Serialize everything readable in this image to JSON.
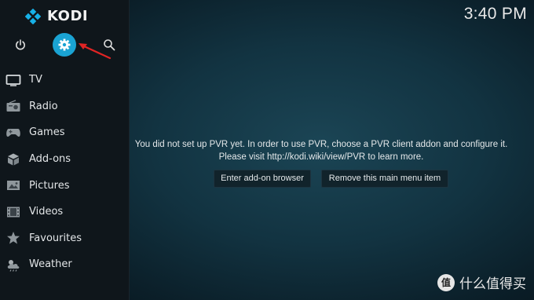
{
  "app": {
    "brand": "KODI",
    "clock": "3:40 PM"
  },
  "top_icons": [
    "power-icon",
    "settings-icon",
    "search-icon"
  ],
  "menu": [
    {
      "label": "TV",
      "icon": "tv-icon"
    },
    {
      "label": "Radio",
      "icon": "radio-icon"
    },
    {
      "label": "Games",
      "icon": "gamepad-icon"
    },
    {
      "label": "Add-ons",
      "icon": "addon-box-icon"
    },
    {
      "label": "Pictures",
      "icon": "picture-icon"
    },
    {
      "label": "Videos",
      "icon": "film-icon"
    },
    {
      "label": "Favourites",
      "icon": "star-icon"
    },
    {
      "label": "Weather",
      "icon": "weather-icon"
    }
  ],
  "main": {
    "message": "You did not set up PVR yet. In order to use PVR, choose a PVR client addon and configure it. Please visit http://kodi.wiki/view/PVR to learn more.",
    "buttons": {
      "addon": "Enter add-on browser",
      "remove": "Remove this main menu item"
    }
  },
  "watermark": {
    "badge": "值",
    "text": "什么值得买"
  },
  "colors": {
    "accent": "#1aa3d3",
    "sidebar": "#0f161b",
    "annotation_arrow": "#e02424"
  }
}
